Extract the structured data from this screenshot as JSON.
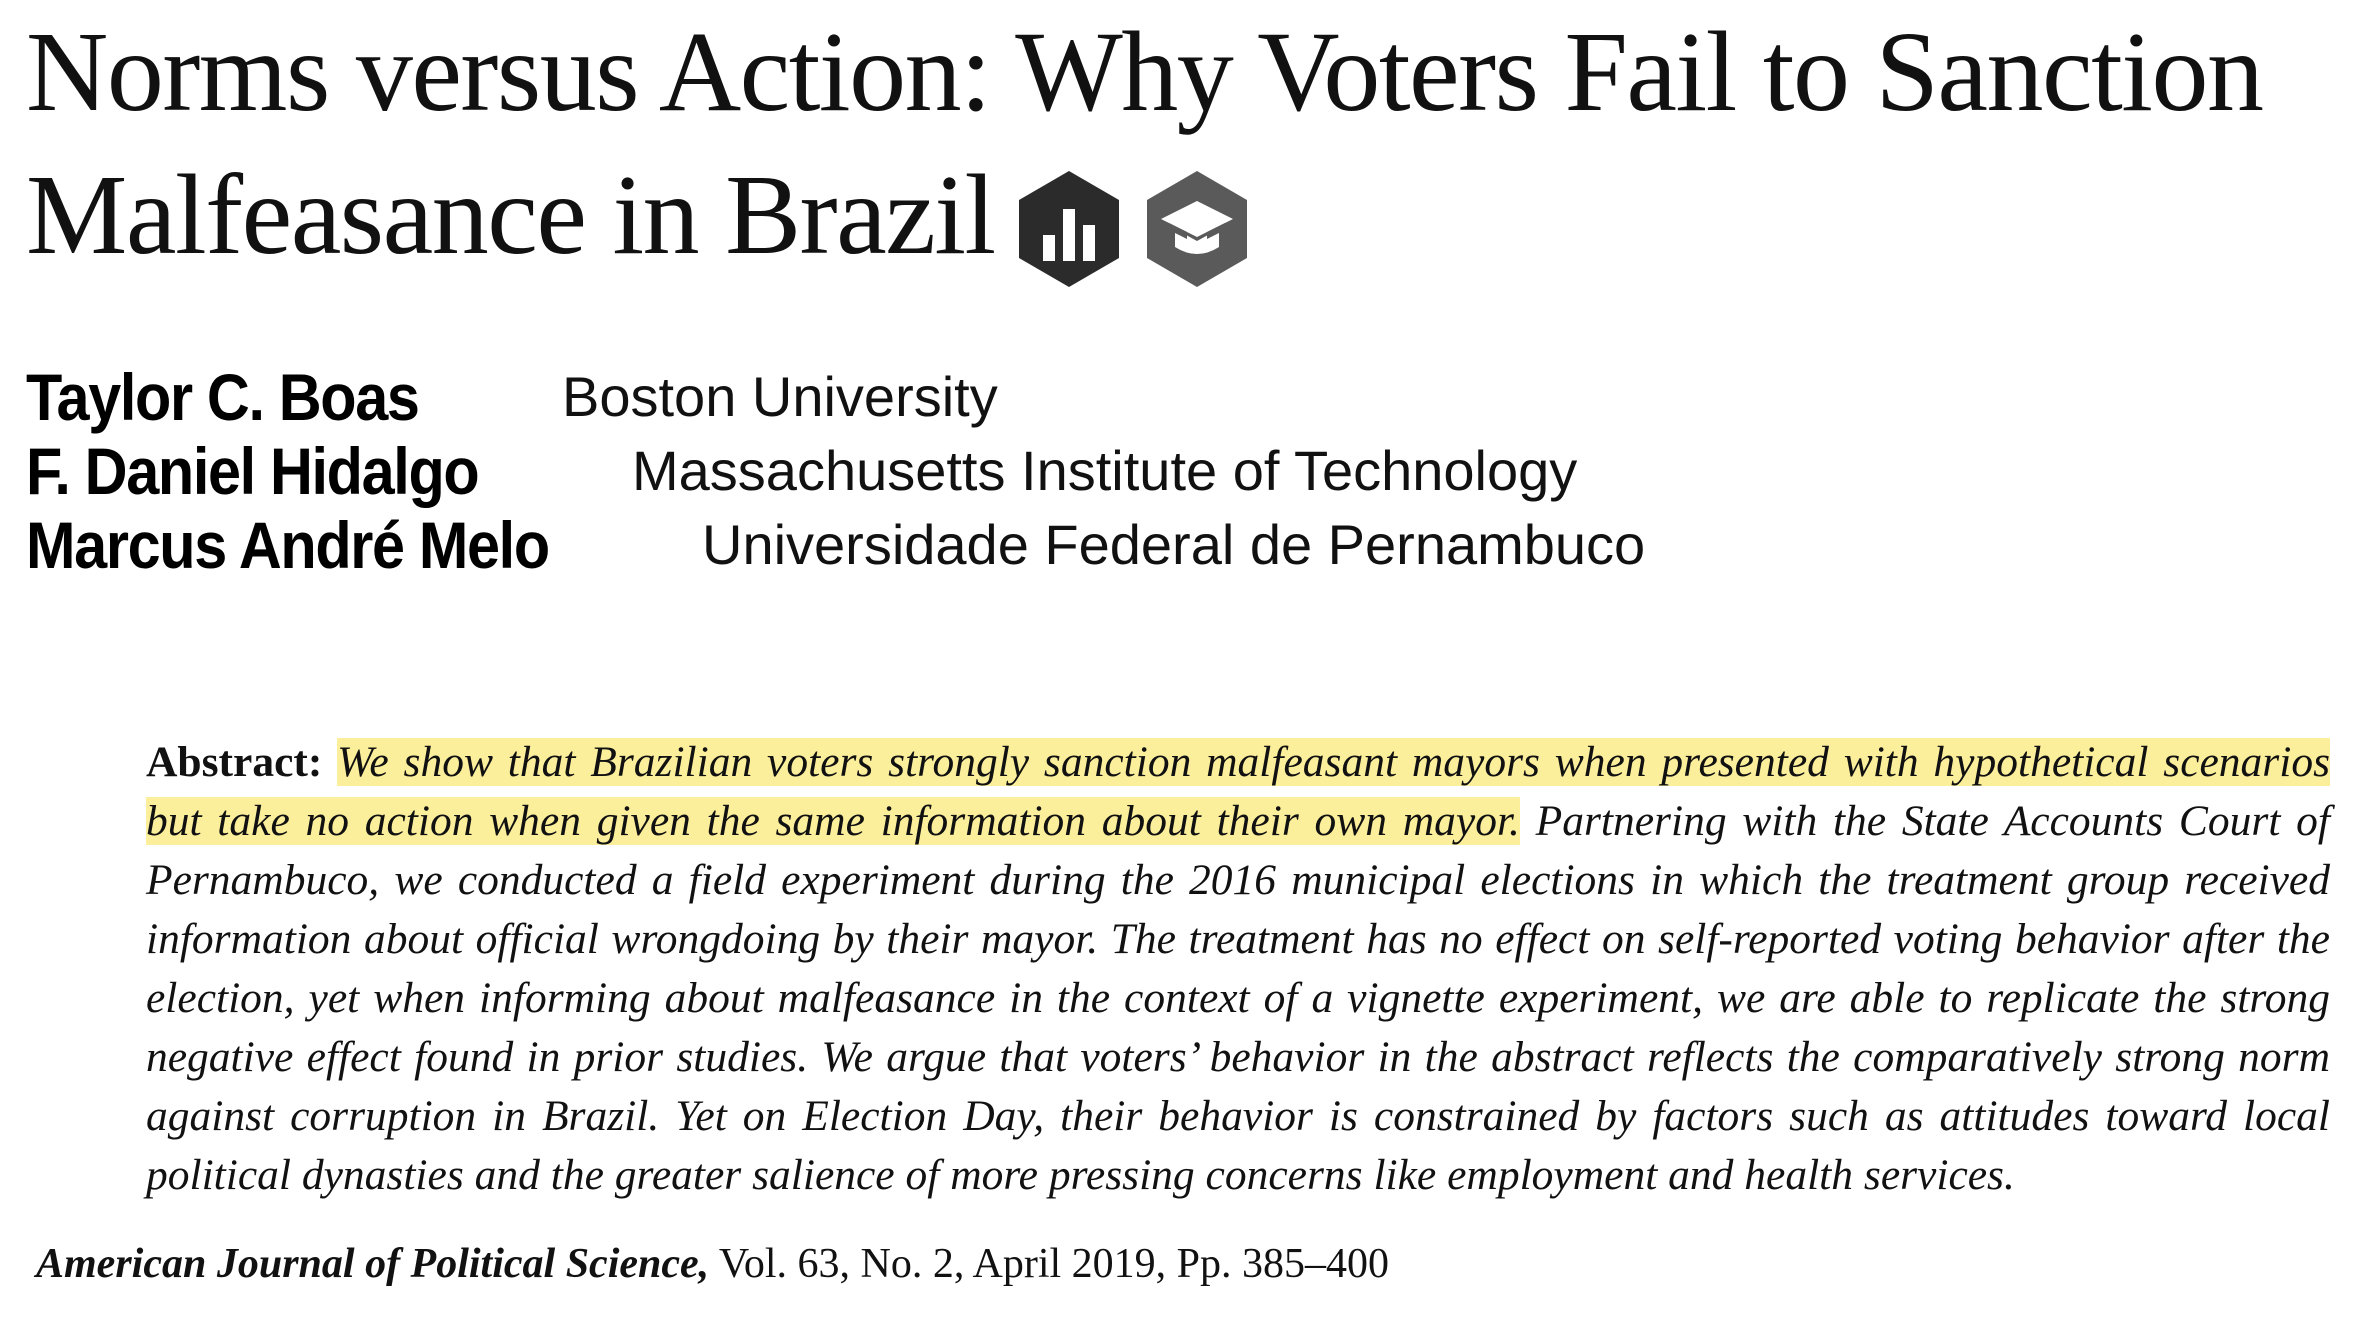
{
  "title": {
    "line1": "Norms versus Action: Why Voters Fail to Sanction",
    "line2": "Malfeasance in Brazil"
  },
  "badges": [
    {
      "icon": "bar-chart-icon",
      "color": "#2b2b2b"
    },
    {
      "icon": "graduation-cap-icon",
      "color": "#5a5a5a"
    }
  ],
  "authors": [
    {
      "name": "Taylor C. Boas",
      "affiliation": "Boston University"
    },
    {
      "name": "F. Daniel Hidalgo",
      "affiliation": "Massachusetts Institute of Technology"
    },
    {
      "name": "Marcus André Melo",
      "affiliation": "Universidade Federal de Pernambuco"
    }
  ],
  "abstract": {
    "label": "Abstract:",
    "highlighted": "We show that Brazilian voters strongly sanction malfeasant mayors when presented with hypothetical scenarios but take no action when given the same information about their own mayor.",
    "rest": "Partnering with the State Accounts Court of Pernambuco, we conducted a field experiment during the 2016 municipal elections in which the treatment group received information about official wrongdoing by their mayor. The treatment has no effect on self-reported voting behavior after the election, yet when informing about malfeasance in the context of a vignette experiment, we are able to replicate the strong negative effect found in prior studies. We argue that voters’ behavior in the abstract reflects the comparatively strong norm against corruption in Brazil. Yet on Election Day, their behavior is constrained by factors such as attitudes toward local political dynasties and the greater salience of more pressing concerns like employment and health services.",
    "highlight_color": "#fcef9c"
  },
  "citation": {
    "journal": "American Journal of Political Science,",
    "details": "Vol. 63, No. 2, April 2019, Pp. 385–400"
  }
}
